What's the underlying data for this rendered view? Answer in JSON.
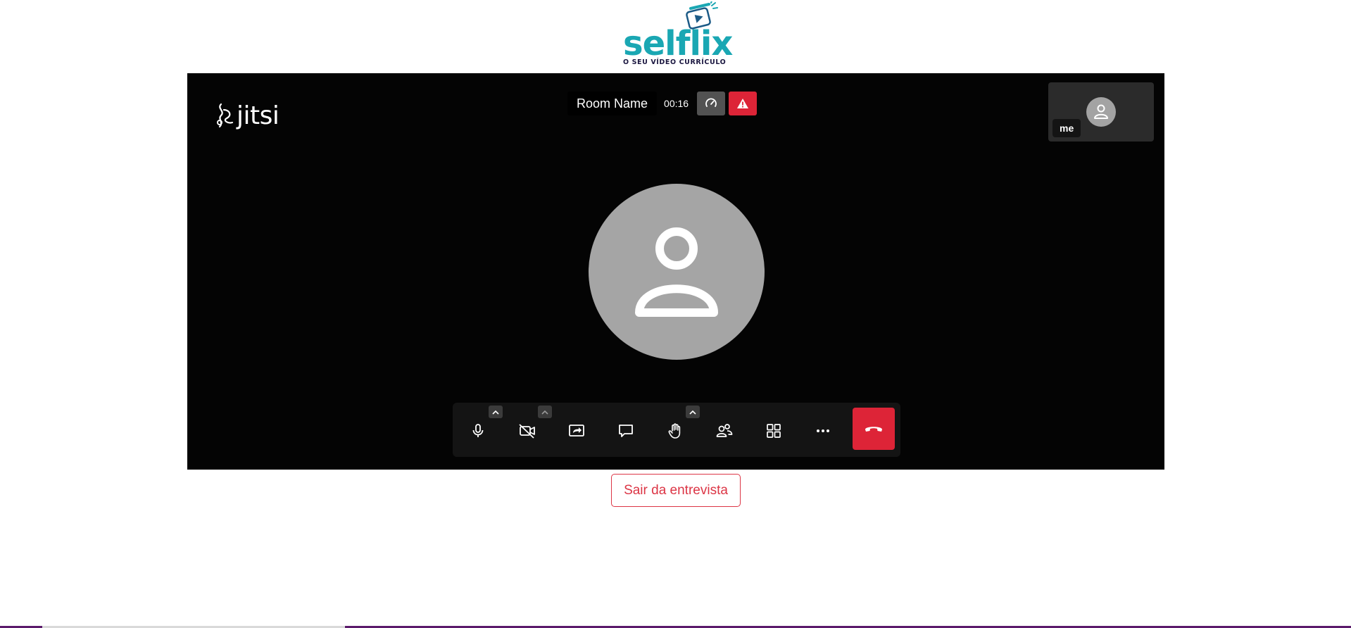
{
  "brand": {
    "name": "selflix",
    "tagline": "O SEU VÍDEO CURRÍCULO",
    "colors": {
      "word": "#1aa7b3",
      "tagline": "#1b1740"
    }
  },
  "meeting": {
    "logo_text": "jitsi",
    "room_name": "Room Name",
    "timer": "00:16",
    "self_view": {
      "name": "me"
    },
    "icons": {
      "connection": "speedometer-icon",
      "warning": "warning-triangle-icon",
      "avatar": "user-avatar-icon"
    },
    "toolbar": {
      "buttons": [
        {
          "name": "microphone",
          "icon": "microphone-icon",
          "has_menu": true
        },
        {
          "name": "camera",
          "icon": "camera-off-icon",
          "has_menu": true
        },
        {
          "name": "share-screen",
          "icon": "screen-share-icon",
          "has_menu": false
        },
        {
          "name": "chat",
          "icon": "chat-icon",
          "has_menu": false
        },
        {
          "name": "raise-hand",
          "icon": "hand-icon",
          "has_menu": true
        },
        {
          "name": "participants",
          "icon": "participants-icon",
          "has_menu": false
        },
        {
          "name": "tile-view",
          "icon": "grid-icon",
          "has_menu": false
        },
        {
          "name": "more",
          "icon": "more-horizontal-icon",
          "has_menu": false
        },
        {
          "name": "hangup",
          "icon": "phone-hangup-icon",
          "has_menu": false
        }
      ]
    },
    "colors": {
      "background": "#040404",
      "danger": "#dd2437"
    }
  },
  "actions": {
    "leave_label": "Sair da entrevista",
    "leave_color": "#dc3545"
  }
}
